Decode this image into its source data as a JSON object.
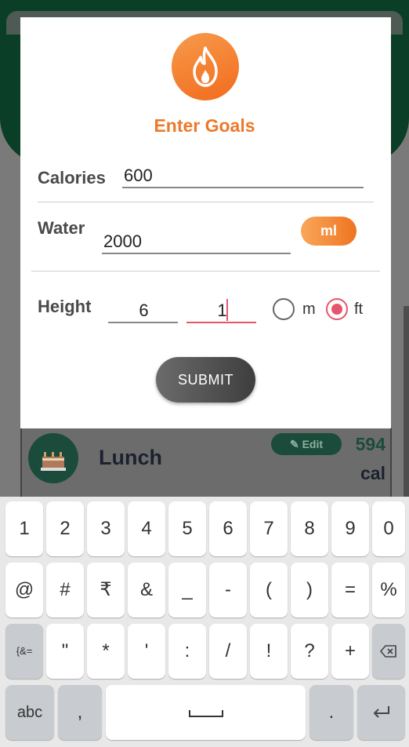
{
  "background": {
    "meal_name": "Lunch",
    "edit_label": "Edit",
    "calories_value": "594",
    "calories_unit": "cal",
    "meal_icon": "cake-icon"
  },
  "dialog": {
    "icon": "fire-icon",
    "title": "Enter Goals",
    "calories": {
      "label": "Calories",
      "value": "600"
    },
    "water": {
      "label": "Water",
      "value": "2000",
      "unit_button": "ml"
    },
    "height": {
      "label": "Height",
      "value_major": "6",
      "value_minor": "1",
      "units": [
        {
          "label": "m",
          "selected": false
        },
        {
          "label": "ft",
          "selected": true
        }
      ]
    },
    "submit_label": "SUBMIT"
  },
  "colors": {
    "accent_orange": "#ec7a2a",
    "radio_selected": "#e5566d",
    "header_green": "#0b3e26"
  },
  "keyboard": {
    "row1": [
      "1",
      "2",
      "3",
      "4",
      "5",
      "6",
      "7",
      "8",
      "9",
      "0"
    ],
    "row2": [
      "@",
      "#",
      "₹",
      "&",
      "_",
      "-",
      "(",
      ")",
      "=",
      "%"
    ],
    "row3": {
      "symbols_key": "{&=",
      "keys": [
        "\"",
        "*",
        "'",
        ":",
        "/",
        "!",
        "?",
        "+"
      ],
      "backspace_icon": "backspace-icon"
    },
    "row4": {
      "abc_key": "abc",
      "comma_key": ",",
      "space_icon": "space-icon",
      "period_key": ".",
      "enter_icon": "enter-icon"
    }
  }
}
